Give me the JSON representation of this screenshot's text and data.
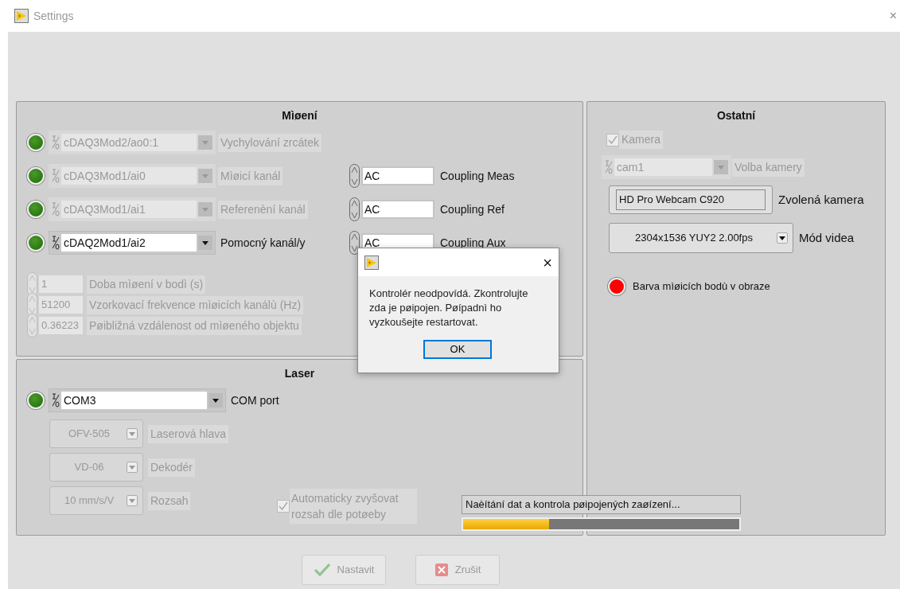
{
  "window": {
    "title": "Settings",
    "close": "×"
  },
  "measurement": {
    "title": "Mìøení",
    "channels": [
      {
        "value": "cDAQ3Mod2/ao0:1",
        "label": "Vychylování zrcátek",
        "disabled": true,
        "led_on": true
      },
      {
        "value": "cDAQ3Mod1/ai0",
        "label": "Mìøicí kanál",
        "disabled": true,
        "led_on": true,
        "coupling": {
          "value": "AC",
          "label": "Coupling Meas"
        }
      },
      {
        "value": "cDAQ3Mod1/ai1",
        "label": "Referenèní kanál",
        "disabled": true,
        "led_on": true,
        "coupling": {
          "value": "AC",
          "label": "Coupling Ref"
        }
      },
      {
        "value": "cDAQ2Mod1/ai2",
        "label": "Pomocný kanál/y",
        "disabled": false,
        "led_on": true,
        "coupling": {
          "value": "AC",
          "label": "Coupling Aux"
        }
      }
    ],
    "numerics": [
      {
        "value": "1",
        "label": "Doba mìøení v bodì (s)",
        "disabled": true
      },
      {
        "value": "51200",
        "label": "Vzorkovací frekvence mìøicích kanálù (Hz)",
        "disabled": true
      },
      {
        "value": "0.36223",
        "label": "Pøibližná vzdálenost od mìøeného objektu",
        "disabled": true
      }
    ]
  },
  "laser": {
    "title": "Laser",
    "port": {
      "value": "COM3",
      "label": "COM port",
      "disabled": false,
      "led_on": true
    },
    "rings": [
      {
        "value": "OFV-505",
        "label": "Laserová hlava",
        "disabled": true
      },
      {
        "value": "VD-06",
        "label": "Dekodér",
        "disabled": true
      },
      {
        "value": "10 mm/s/V",
        "label": "Rozsah",
        "disabled": true
      }
    ],
    "auto_range": {
      "label": "Automaticky zvyšovat rozsah dle potøeby",
      "checked": true,
      "disabled": true
    }
  },
  "other": {
    "title": "Ostatní",
    "camera": {
      "label": "Kamera",
      "checked": true,
      "disabled": true
    },
    "camera_select": {
      "value": "cam1",
      "label": "Volba kamery",
      "disabled": true
    },
    "selected_camera": {
      "value": "HD Pro Webcam C920",
      "label": "Zvolená kamera"
    },
    "video_mode": {
      "value": "2304x1536 YUY2 2.00fps",
      "label": "Mód videa",
      "disabled": false
    },
    "point_color": {
      "label": "Barva mìøicích bodù v obraze",
      "color": "#ff0000"
    }
  },
  "status": {
    "text": "Naèítání dat a kontrola pøipojených zaøízení...",
    "level": 0.31
  },
  "buttons": [
    {
      "label": "Nastavit",
      "kind": "ok",
      "disabled": true
    },
    {
      "label": "Zrušit",
      "kind": "cancel",
      "disabled": true
    }
  ],
  "dialog": {
    "message": "Kontrolér neodpovídá. Zkontrolujte zda je pøipojen. Pøípadnì ho vyzkoušejte restartovat.",
    "button": "OK",
    "close": "×"
  }
}
